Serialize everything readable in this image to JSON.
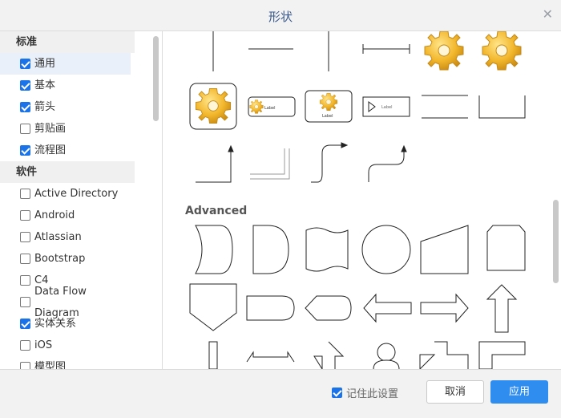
{
  "dialog": {
    "title": "形状",
    "close_icon": "close-icon"
  },
  "sidebar": {
    "sections": [
      {
        "header": "标准",
        "items": [
          {
            "label": "通用",
            "checked": true,
            "selected": true
          },
          {
            "label": "基本",
            "checked": true
          },
          {
            "label": "箭头",
            "checked": true
          },
          {
            "label": "剪贴画",
            "checked": false
          },
          {
            "label": "流程图",
            "checked": true
          }
        ]
      },
      {
        "header": "软件",
        "items": [
          {
            "label": "Active Directory",
            "checked": false
          },
          {
            "label": "Android",
            "checked": false
          },
          {
            "label": "Atlassian",
            "checked": false
          },
          {
            "label": "Bootstrap",
            "checked": false
          },
          {
            "label": "C4",
            "checked": false
          },
          {
            "label": "Data Flow Diagram",
            "checked": false
          },
          {
            "label": "实体关系",
            "checked": true
          },
          {
            "label": "iOS",
            "checked": false
          },
          {
            "label": "模型图",
            "checked": false
          }
        ]
      }
    ]
  },
  "gallery": {
    "advanced_header": "Advanced",
    "mini_label": "Label"
  },
  "footer": {
    "remember_label": "记住此设置",
    "remember_checked": true,
    "cancel_label": "取消",
    "apply_label": "应用"
  },
  "colors": {
    "accent": "#2f8df0",
    "title": "#3a5a8c",
    "gear": "#f0b429"
  }
}
